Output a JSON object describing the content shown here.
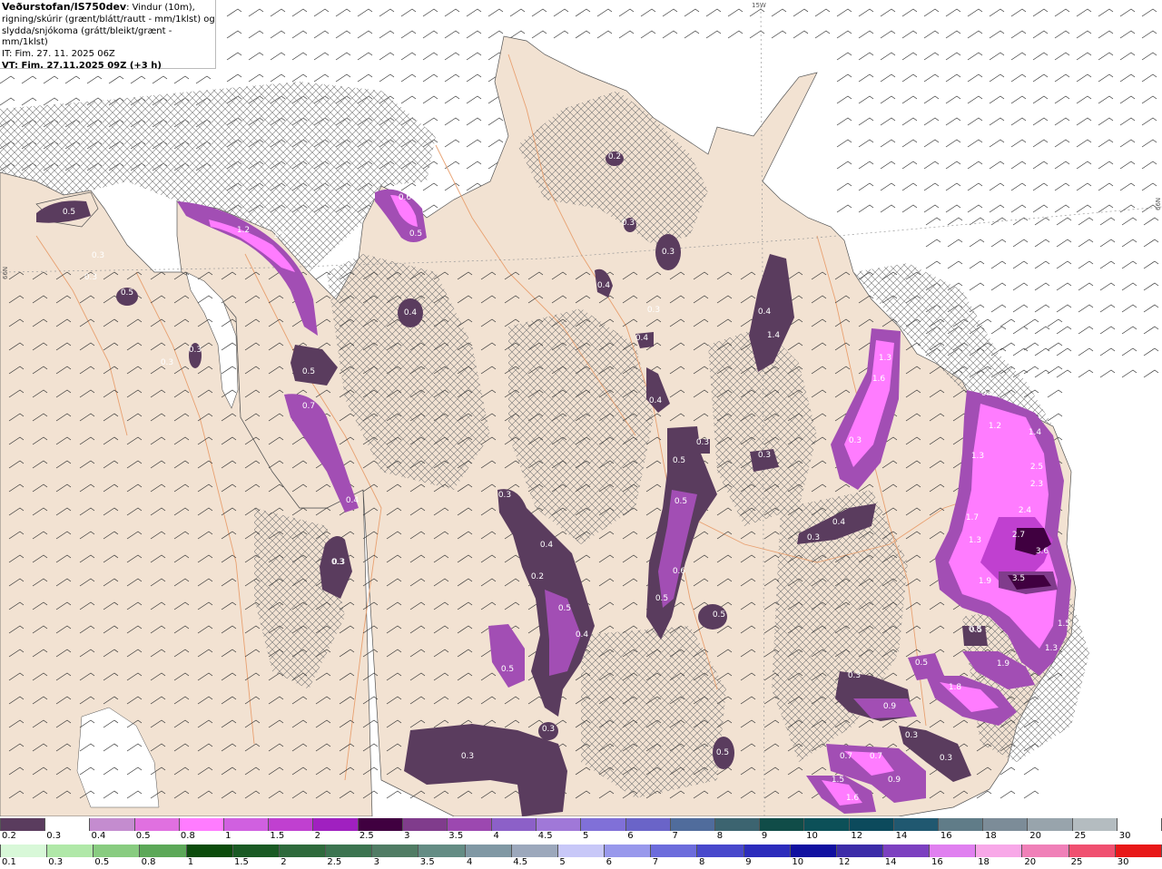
{
  "header": {
    "brand": "Veðurstofan/IS750dev",
    "desc_1": ": Vindur (10m),",
    "desc_2": "rigning/skúrir (grænt/blátt/rautt - mm/1klst) og",
    "desc_3": "slydda/snjókoma (grátt/bleikt/grænt - mm/1klst)",
    "issue_time": "IT: Fim. 27. 11. 2025 06Z",
    "valid_time": "VT: Fim. 27.11.2025 09Z (+3 h)"
  },
  "graticule": {
    "lon_label": "15W",
    "lat_label_left": "66N",
    "lat_label_right": "66N"
  },
  "colors": {
    "land": "#f2e2d2",
    "sea": "#ffffff",
    "border": "#e8a070",
    "hatch": "#777777"
  },
  "cells": [
    {
      "value": "0.5",
      "level": 1
    },
    {
      "value": "0.3",
      "level": 0
    },
    {
      "value": "1.2",
      "level": 2
    },
    {
      "value": "1.5",
      "level": 2
    },
    {
      "value": "0.6",
      "level": 2
    },
    {
      "value": "0.5",
      "level": 1
    },
    {
      "value": "0.3",
      "level": 0
    },
    {
      "value": "0.5",
      "level": 1
    },
    {
      "value": "0.3",
      "level": 0
    },
    {
      "value": "0.3",
      "level": 0
    },
    {
      "value": "0.5",
      "level": 1
    },
    {
      "value": "0.7",
      "level": 1
    },
    {
      "value": "0.4",
      "level": 0
    },
    {
      "value": "0.3",
      "level": 0
    },
    {
      "value": "0.4",
      "level": 0
    },
    {
      "value": "0.2",
      "level": 0
    },
    {
      "value": "0.3",
      "level": 0
    },
    {
      "value": "0.3",
      "level": 0
    },
    {
      "value": "0.4",
      "level": 0
    },
    {
      "value": "0.3",
      "level": 0
    },
    {
      "value": "0.4",
      "level": 0
    },
    {
      "value": "0.4",
      "level": 0
    },
    {
      "value": "1.4",
      "level": 2
    },
    {
      "value": "1.3",
      "level": 2
    },
    {
      "value": "1.6",
      "level": 2
    },
    {
      "value": "0.3",
      "level": 0
    },
    {
      "value": "0.4",
      "level": 0
    },
    {
      "value": "0.5",
      "level": 1
    },
    {
      "value": "0.3",
      "level": 0
    },
    {
      "value": "0.3",
      "level": 0
    },
    {
      "value": "0.3",
      "level": 0
    },
    {
      "value": "0.4",
      "level": 0
    },
    {
      "value": "0.3",
      "level": 0
    },
    {
      "value": "0.5",
      "level": 1
    },
    {
      "value": "0.4",
      "level": 0
    },
    {
      "value": "0.4",
      "level": 0
    },
    {
      "value": "0.5",
      "level": 1
    },
    {
      "value": "0.2",
      "level": 0
    },
    {
      "value": "0.3",
      "level": 0
    },
    {
      "value": "0.6",
      "level": 1
    },
    {
      "value": "0.5",
      "level": 1
    },
    {
      "value": "0.5",
      "level": 1
    },
    {
      "value": "0.3",
      "level": 0
    },
    {
      "value": "0.3",
      "level": 0
    },
    {
      "value": "0.5",
      "level": 1
    },
    {
      "value": "0.5",
      "level": 1
    },
    {
      "value": "0.3",
      "level": 0
    },
    {
      "value": "0.3",
      "level": 0
    },
    {
      "value": "0.9",
      "level": 1
    },
    {
      "value": "0.7",
      "level": 1
    },
    {
      "value": "0.7",
      "level": 1
    },
    {
      "value": "0.9",
      "level": 1
    },
    {
      "value": "1.5",
      "level": 2
    },
    {
      "value": "1.6",
      "level": 2
    },
    {
      "value": "0.3",
      "level": 0
    },
    {
      "value": "0.5",
      "level": 1
    },
    {
      "value": "0.8",
      "level": 1
    },
    {
      "value": "1.8",
      "level": 2
    },
    {
      "value": "1.9",
      "level": 2
    },
    {
      "value": "0.5",
      "level": 1
    },
    {
      "value": "1.5",
      "level": 2
    },
    {
      "value": "1.3",
      "level": 2
    },
    {
      "value": "1.9",
      "level": 2
    },
    {
      "value": "3.5",
      "level": 3
    },
    {
      "value": "3.6",
      "level": 3
    },
    {
      "value": "2.7",
      "level": 3
    },
    {
      "value": "1.3",
      "level": 2
    },
    {
      "value": "1.7",
      "level": 2
    },
    {
      "value": "2.4",
      "level": 3
    },
    {
      "value": "2.3",
      "level": 3
    },
    {
      "value": "2.5",
      "level": 3
    },
    {
      "value": "1.3",
      "level": 2
    },
    {
      "value": "1.2",
      "level": 2
    },
    {
      "value": "1.4",
      "level": 2
    },
    {
      "value": "0.8",
      "level": 1
    }
  ],
  "scale_top": {
    "labels": [
      "0.2",
      "0.3",
      "0.4",
      "0.5",
      "0.8",
      "1",
      "1.5",
      "2",
      "2.5",
      "3",
      "3.5",
      "4",
      "4.5",
      "5",
      "6",
      "7",
      "8",
      "9",
      "10",
      "12",
      "14",
      "16",
      "18",
      "20",
      "25",
      "30"
    ],
    "colors": [
      "#5a3c5e",
      "#ffffff",
      "#c48ccf",
      "#e070e0",
      "#ff7cff",
      "#d060e0",
      "#c040d0",
      "#a020c0",
      "#400040",
      "#803c8c",
      "#9c48b0",
      "#8c60c8",
      "#a078d8",
      "#8070d8",
      "#6a64c8",
      "#506c9c",
      "#3c6470",
      "#104c48",
      "#0c5058",
      "#0c4a5c",
      "#205870",
      "#607c88",
      "#7c8c98",
      "#98a4ac",
      "#b4bcc0",
      "#ffffff"
    ]
  },
  "scale_bottom": {
    "labels": [
      "0.1",
      "0.3",
      "0.5",
      "0.8",
      "1",
      "1.5",
      "2",
      "2.5",
      "3",
      "3.5",
      "4",
      "4.5",
      "5",
      "6",
      "7",
      "8",
      "9",
      "10",
      "12",
      "14",
      "16",
      "18",
      "20",
      "25",
      "30"
    ],
    "colors": [
      "#d8f8d8",
      "#b0e8a8",
      "#88cc80",
      "#5ca858",
      "#0c4c0c",
      "#1a5a24",
      "#2e6a3c",
      "#3c7450",
      "#507c64",
      "#648c84",
      "#8098a4",
      "#9ca8bc",
      "#c8c8f8",
      "#9898ec",
      "#6c6cdc",
      "#4848cc",
      "#2c2cbc",
      "#1010a0",
      "#3c2ca8",
      "#7c40c0",
      "#e080f0",
      "#f8a8e8",
      "#f080b8",
      "#f05070",
      "#e81818"
    ]
  }
}
